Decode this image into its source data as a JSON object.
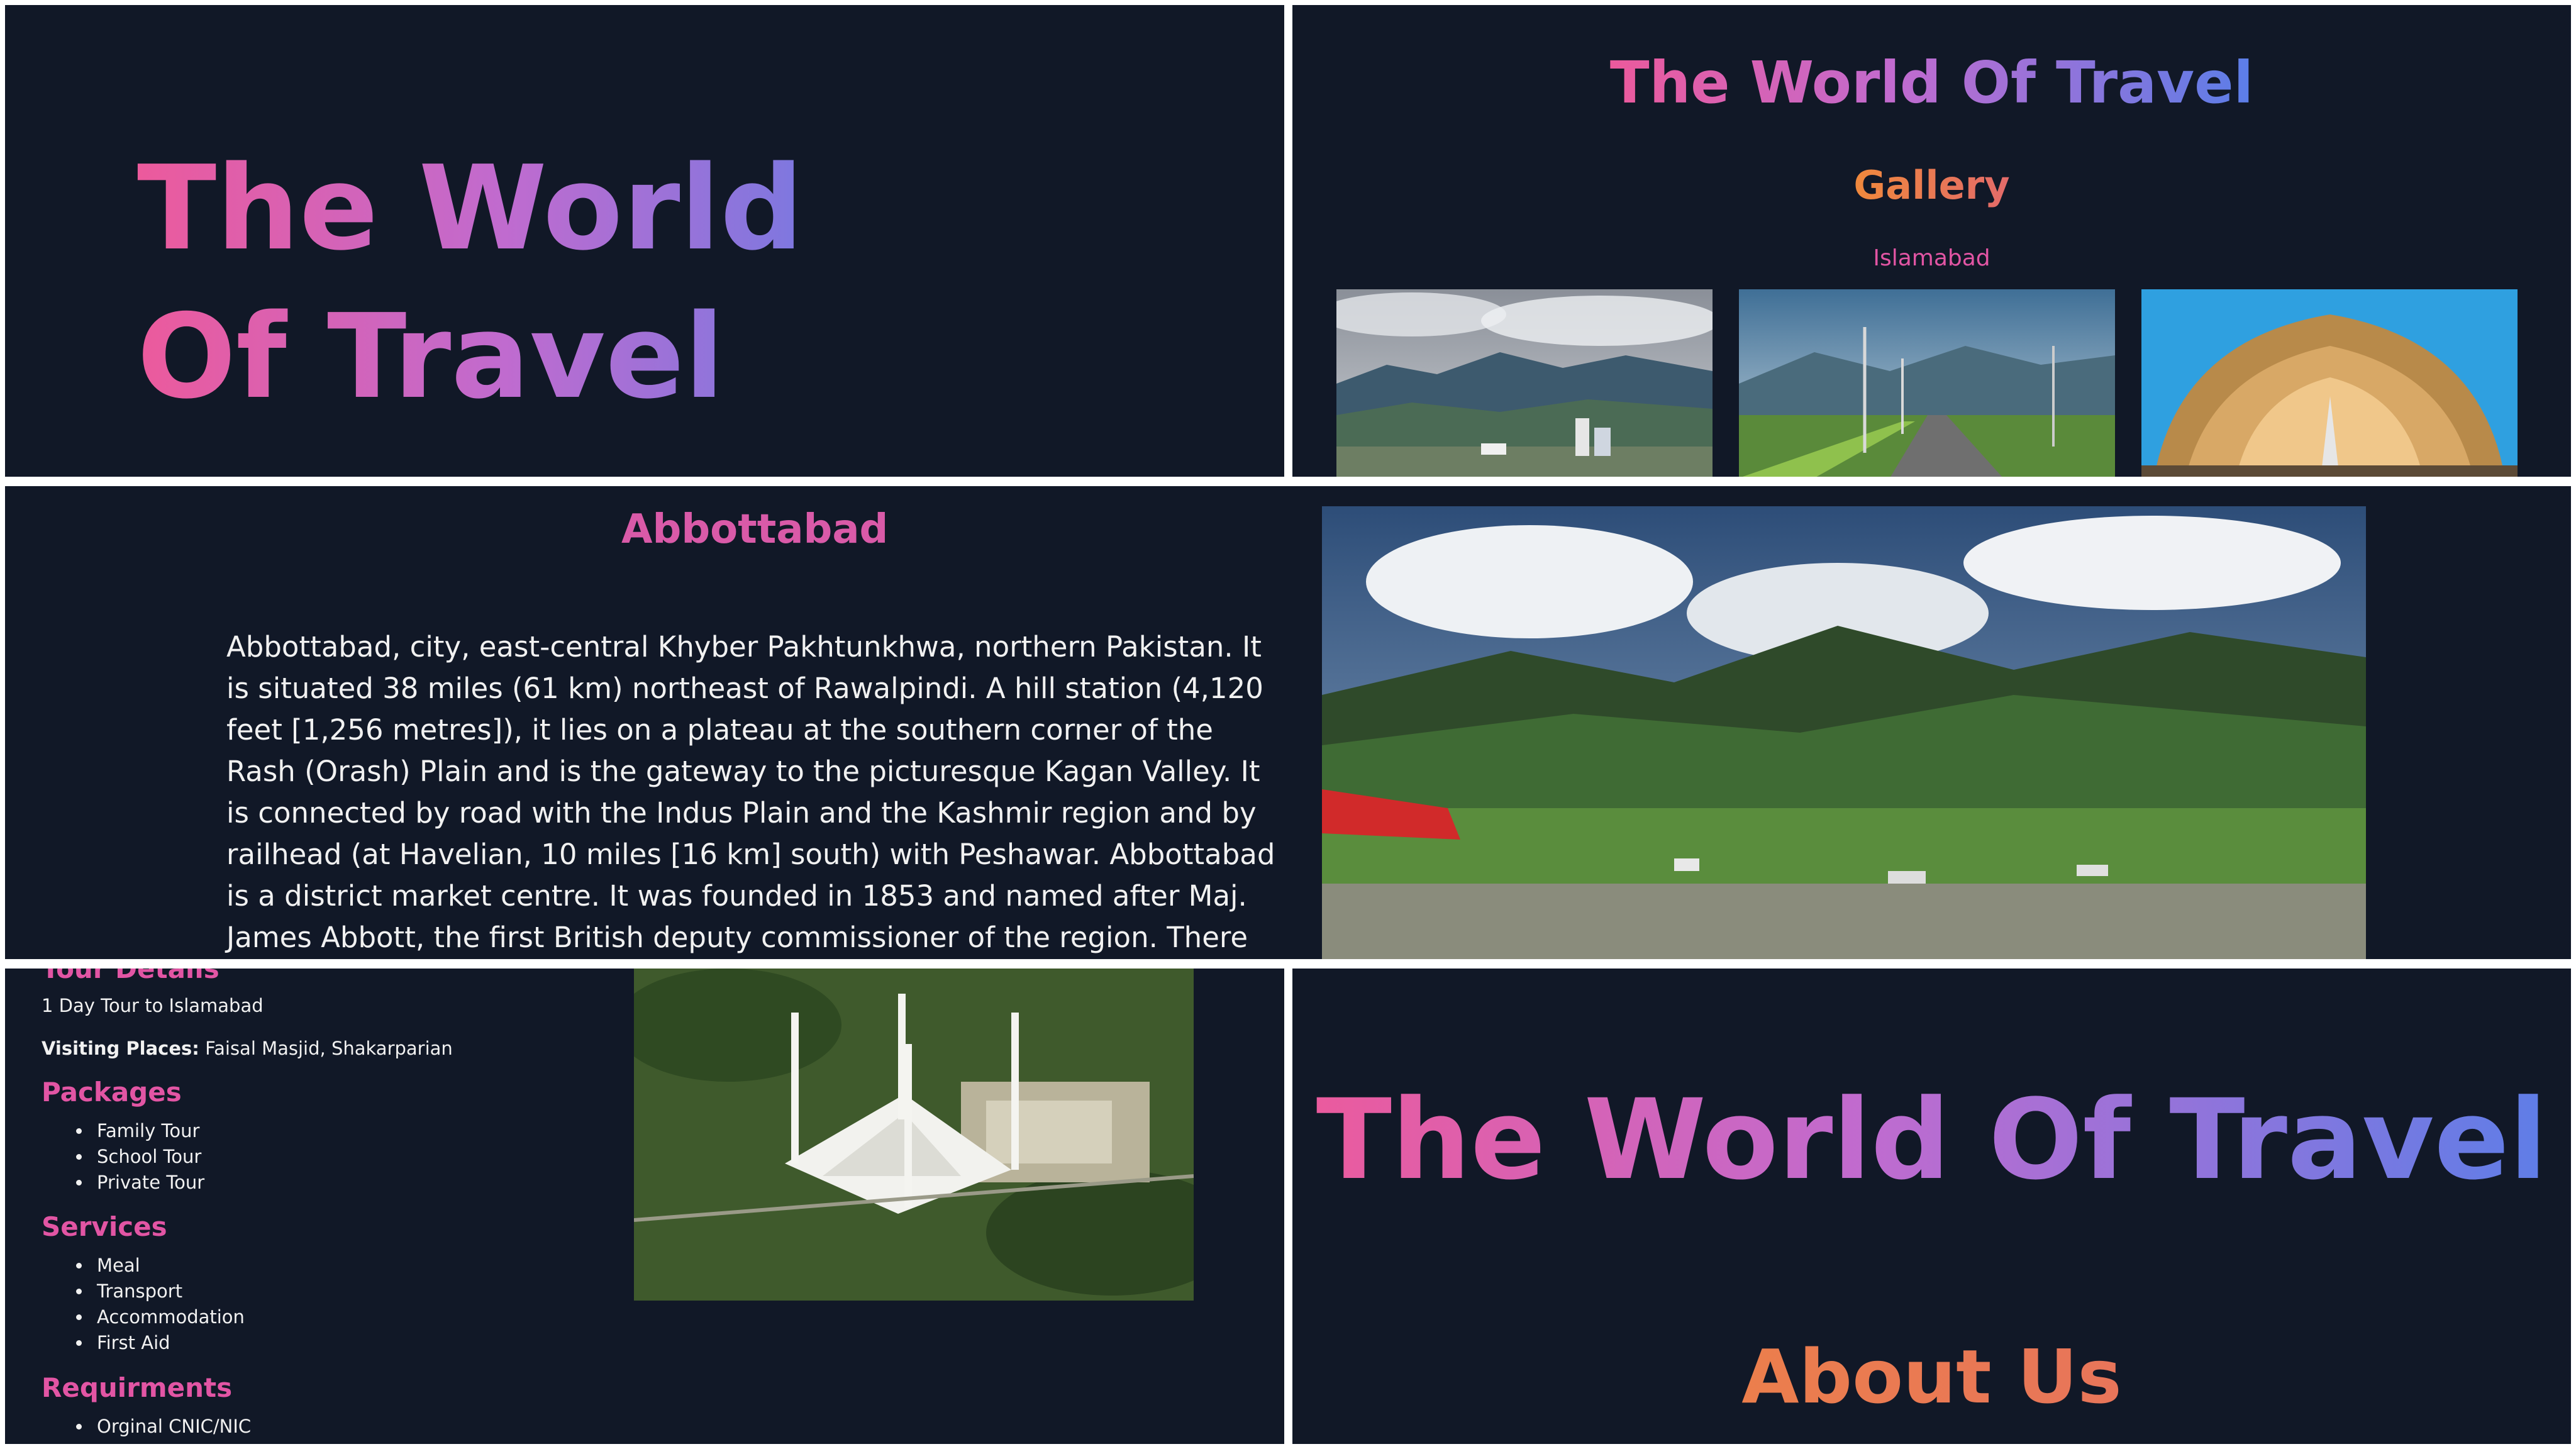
{
  "panel1": {
    "hero_title": "The World Of Travel"
  },
  "panel2": {
    "site_title": "The World Of Travel",
    "gallery_heading": "Gallery",
    "city_label": "Islamabad",
    "images": [
      "islamabad-city-view-image",
      "islamabad-highway-image",
      "pakistan-monument-image"
    ]
  },
  "panel3": {
    "heading": "Abbottabad",
    "description": "Abbottabad, city, east-central Khyber Pakhtunkhwa, northern Pakistan. It is situated 38 miles (61 km) northeast of Rawalpindi. A hill station (4,120 feet [1,256 metres]), it lies on a plateau at the southern corner of the Rash (Orash) Plain and is the gateway to the picturesque Kagan Valley. It is connected by road with the Indus Plain and the Kashmir region and by railhead (at Havelian, 10 miles [16 km] south) with Peshawar. Abbottabad is a district market centre. It was founded in 1853 and named after Maj. James Abbott, the first British deputy commissioner of the region. There are parks, a preparatory school, several colleges affiliated with the University of",
    "image": "abbottabad-valley-image"
  },
  "panel4": {
    "tour_details_heading": "Tour Details",
    "tour_line": "1 Day Tour to Islamabad",
    "visiting_label": "Visiting Places:",
    "visiting_value": "Faisal Masjid, Shakarparian",
    "packages_heading": "Packages",
    "packages": [
      "Family Tour",
      "School Tour",
      "Private Tour"
    ],
    "services_heading": "Services",
    "services": [
      "Meal",
      "Transport",
      "Accommodation",
      "First Aid"
    ],
    "requirements_heading": "Requirments",
    "requirements": [
      "Orginal CNIC/NIC"
    ],
    "image": "faisal-masjid-image"
  },
  "panel5": {
    "site_title": "The World Of Travel",
    "about_heading": "About Us"
  },
  "colors": {
    "background": "#111827",
    "pink": "#ec5a9c",
    "violet": "#c06bcf",
    "blue": "#5b7ee8",
    "orange": "#f0893c"
  }
}
